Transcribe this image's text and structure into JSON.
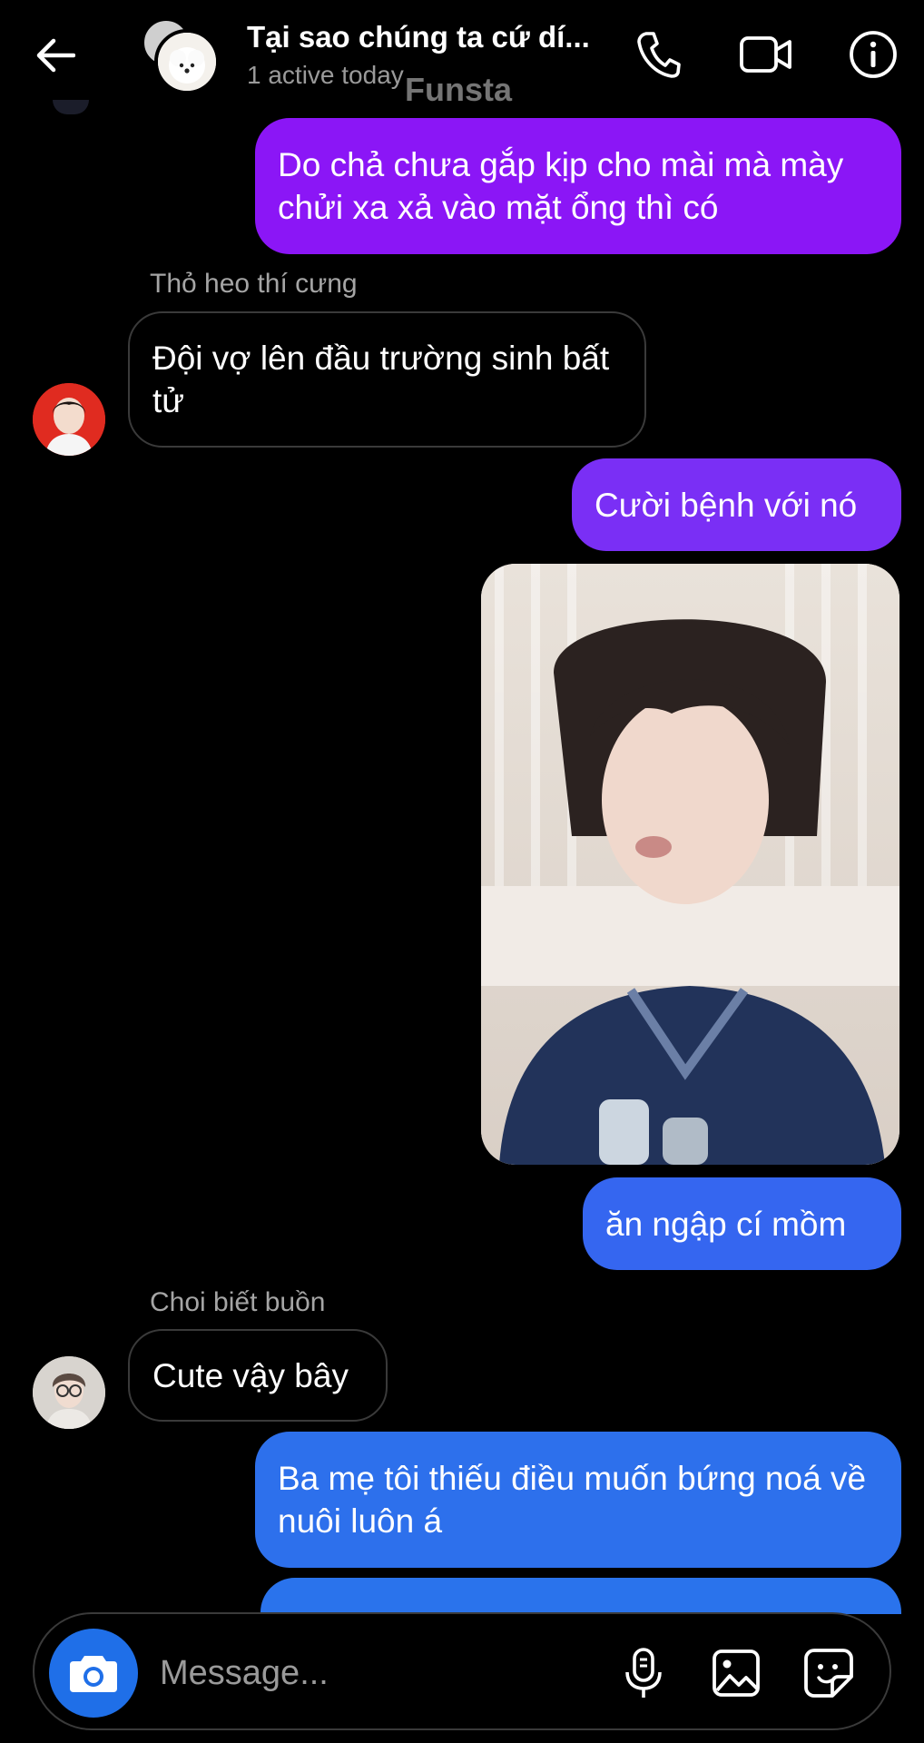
{
  "header": {
    "title": "Tại sao chúng ta cứ dí...",
    "status": "1 active today",
    "watermark": "Funsta",
    "back_icon": "arrow-left-icon",
    "call_icon": "phone-icon",
    "video_icon": "video-camera-icon",
    "info_icon": "info-icon"
  },
  "messages": [
    {
      "direction": "outgoing",
      "text": "Do chả chưa gắp kịp cho mài mà mày chửi xa xả vào mặt ổng thì có",
      "color": "#8b16f6"
    },
    {
      "direction": "incoming",
      "sender": "Thỏ heo thí cưng",
      "text": "Đội vợ lên đầu trường sinh bất tử"
    },
    {
      "direction": "outgoing",
      "text": "Cười bệnh với nó",
      "color": "#7a2ff5"
    },
    {
      "direction": "outgoing",
      "type": "photo"
    },
    {
      "direction": "outgoing",
      "text": "ăn ngập cí mồm",
      "color": "#3566f0"
    },
    {
      "direction": "incoming",
      "sender": "Choi biết buồn",
      "text": "Cute vậy bây"
    },
    {
      "direction": "outgoing",
      "text": "Ba mẹ tôi thiếu điều muốn bứng noá về nuôi luôn á",
      "color": "#2d70ec"
    }
  ],
  "composer": {
    "placeholder": "Message...",
    "camera_icon": "camera-icon",
    "mic_icon": "microphone-icon",
    "gallery_icon": "image-icon",
    "sticker_icon": "sticker-icon"
  },
  "colors": {
    "background": "#000000",
    "accent_blue": "#1f6fe8",
    "accent_purple": "#8b16f6",
    "muted_text": "#9a9a9a"
  }
}
